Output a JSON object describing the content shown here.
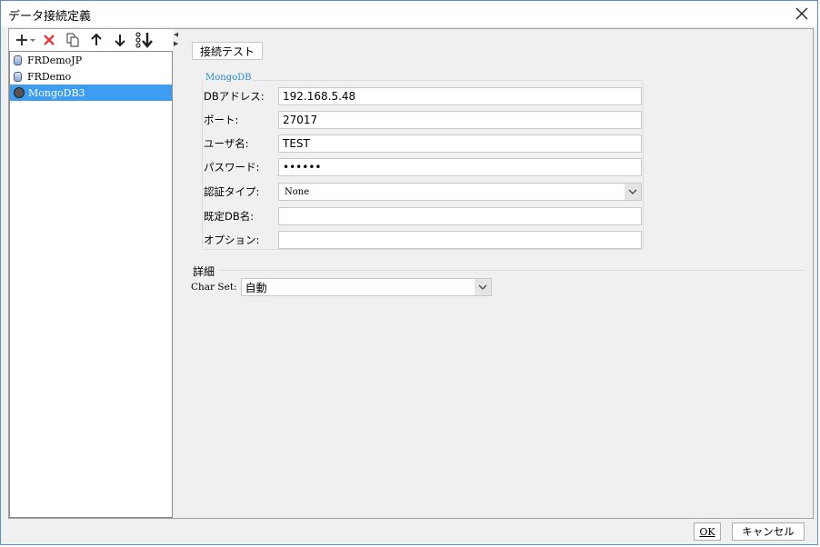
{
  "window": {
    "title": "データ接続定義",
    "close_icon": "close-icon"
  },
  "toolbar": {
    "icons": [
      "add-icon",
      "delete-icon",
      "copy-icon",
      "move-up-icon",
      "move-down-icon",
      "sort-icon"
    ],
    "add_color": "#333333",
    "delete_color": "#e23b3b"
  },
  "tree": {
    "items": [
      {
        "label": "FRDemoJP",
        "icon": "database-icon",
        "selected": false
      },
      {
        "label": "FRDemo",
        "icon": "database-icon",
        "selected": false
      },
      {
        "label": "MongoDB3",
        "icon": "mongodb-icon",
        "selected": true
      }
    ],
    "selected_color": "#3d9df1"
  },
  "main": {
    "test_button_label": "接続テスト",
    "group_legend": "MongoDB",
    "fields": [
      {
        "label": "DBアドレス:",
        "value": "192.168.5.48"
      },
      {
        "label": "ポート:",
        "value": "27017"
      },
      {
        "label": "ユーザ名:",
        "value": "TEST"
      },
      {
        "label": "パスワード:",
        "value": "••••••"
      },
      {
        "label": "認証タイプ:",
        "value": "None"
      },
      {
        "label": "既定DB名:",
        "value": ""
      },
      {
        "label": "オプション:",
        "value": ""
      }
    ],
    "details_title": "詳細",
    "charset_label": "Char Set:",
    "charset_value": "自動"
  },
  "footer": {
    "ok_label": "OK",
    "cancel_label": "キャンセル"
  }
}
